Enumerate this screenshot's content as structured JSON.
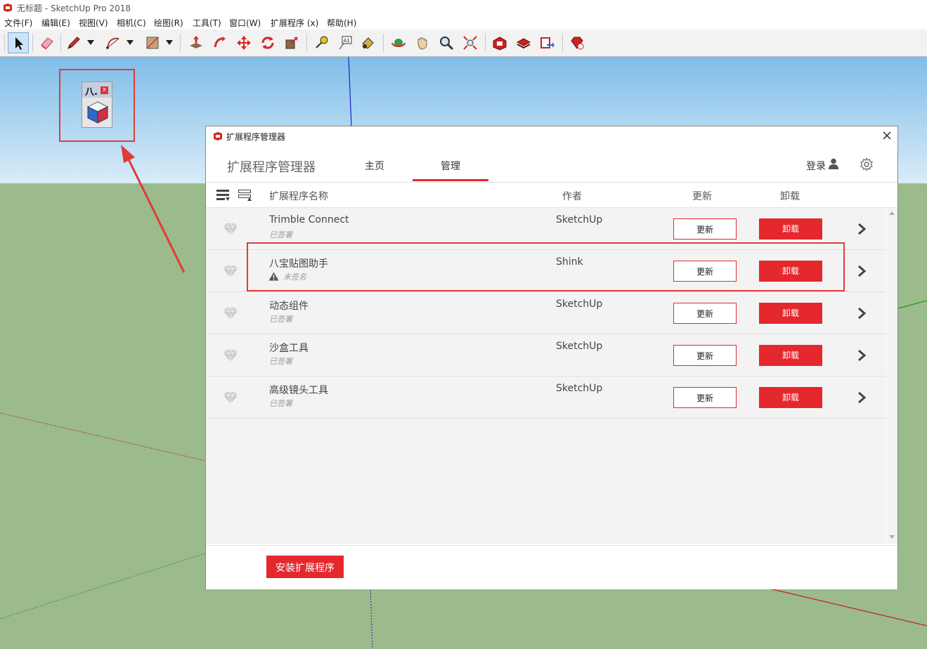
{
  "window": {
    "title": "无标题 - SketchUp Pro 2018"
  },
  "menu": [
    "文件(F)",
    "编辑(E)",
    "视图(V)",
    "相机(C)",
    "绘图(R)",
    "工具(T)",
    "窗口(W)",
    "扩展程序 (x)",
    "帮助(H)"
  ],
  "plugin_toolbar": {
    "label": "八."
  },
  "dialog": {
    "title": "扩展程序管理器",
    "brand": "扩展程序管理器",
    "tabs": [
      "主页",
      "管理"
    ],
    "active_tab": "管理",
    "login": "登录",
    "columns": {
      "name": "扩展程序名称",
      "author": "作者",
      "update": "更新",
      "uninstall": "卸载"
    },
    "extensions": [
      {
        "name": "Trimble Connect",
        "signature": "已签署",
        "signed": true,
        "author": "SketchUp",
        "update_label": "更新",
        "uninstall_label": "卸载"
      },
      {
        "name": "八宝贴图助手",
        "signature": "未签名",
        "signed": false,
        "author": "Shink",
        "update_label": "更新",
        "uninstall_label": "卸载"
      },
      {
        "name": "动态组件",
        "signature": "已签署",
        "signed": true,
        "author": "SketchUp",
        "update_label": "更新",
        "uninstall_label": "卸载"
      },
      {
        "name": "沙盒工具",
        "signature": "已签署",
        "signed": true,
        "author": "SketchUp",
        "update_label": "更新",
        "uninstall_label": "卸载"
      },
      {
        "name": "高级镜头工具",
        "signature": "已签署",
        "signed": true,
        "author": "SketchUp",
        "update_label": "更新",
        "uninstall_label": "卸载"
      }
    ],
    "install_button": "安装扩展程序"
  },
  "colors": {
    "accent": "#e4282d",
    "highlight": "#e23a3a",
    "sky": "#7fbde9",
    "ground": "#9cbb8c"
  }
}
